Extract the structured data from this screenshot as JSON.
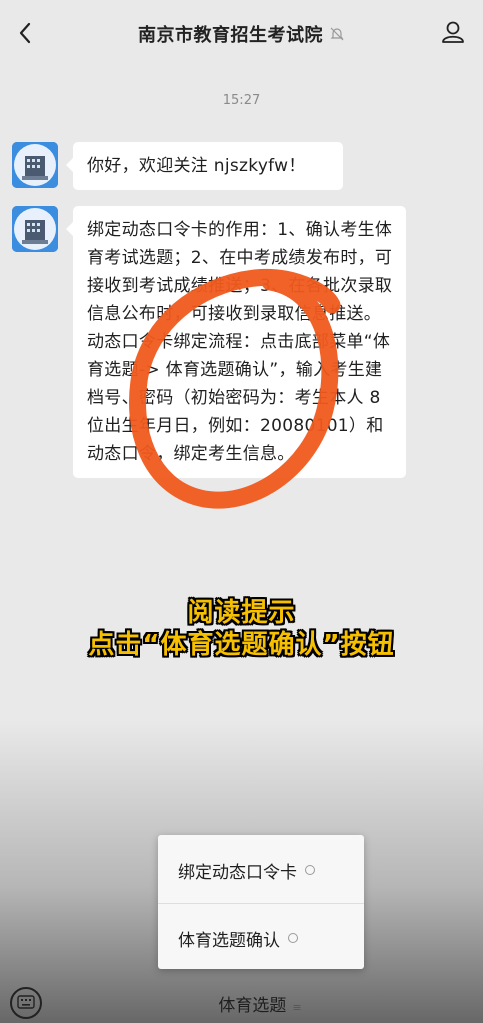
{
  "header": {
    "title": "南京市教育招生考试院",
    "back_icon": "chevron-left-icon",
    "mute_icon": "bell-off-icon",
    "profile_icon": "person-icon"
  },
  "chat": {
    "timestamp": "15:27",
    "messages": [
      {
        "text": "你好，欢迎关注 njszkyfw！"
      },
      {
        "text": "绑定动态口令卡的作用：1、确认考生体育考试选题；2、在中考成绩发布时，可接收到考试成绩推送；3、在各批次录取信息公布时，可接收到录取信息推送。\n动态口令卡绑定流程：点击底部菜单“体育选题-> 体育选题确认”，输入考生建档号、密码（初始密码为：考生本人 8 位出生年月日，例如：20080101）和动态口令，绑定考生信息。"
      }
    ]
  },
  "overlay": {
    "caption_line1": "阅读提示",
    "caption_line2": "点击“体育选题确认”按钮",
    "caption_color": "#f6c000",
    "annotation_color": "#f05a1e"
  },
  "menu": {
    "items": [
      {
        "label": "绑定动态口令卡"
      },
      {
        "label": "体育选题确认"
      }
    ]
  },
  "bottom_bar": {
    "keyboard_icon": "keyboard-icon",
    "tab_label": "体育选题",
    "tab_icon": "menu-lines-icon"
  }
}
